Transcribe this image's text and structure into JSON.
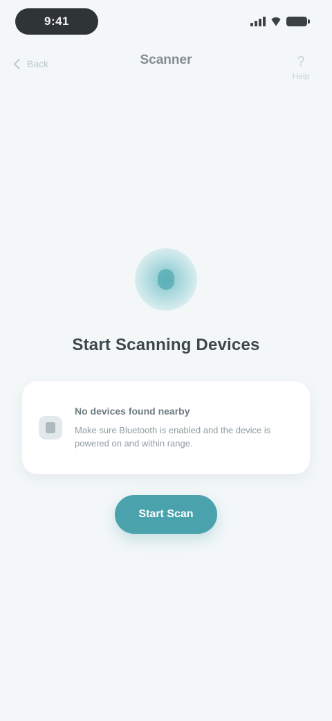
{
  "status_bar": {
    "time": "9:41",
    "icons": [
      "signal-icon",
      "wifi-icon",
      "battery-icon"
    ]
  },
  "nav": {
    "back_label": "Back",
    "title": "Scanner",
    "action_label": "Help",
    "action_icon": "help-icon"
  },
  "empty_state": {
    "illustration_icon": "bluetooth-scan-icon",
    "title": "Start Scanning Devices",
    "card": {
      "icon": "info-icon",
      "heading": "No devices found nearby",
      "body": "Make sure Bluetooth is enabled and the device is powered on and within range."
    },
    "button_label": "Start Scan"
  },
  "colors": {
    "background": "#f3f7f8",
    "accent": "#4aa2ad",
    "title_text": "#3d474c",
    "status_pill": "#2f3436"
  }
}
